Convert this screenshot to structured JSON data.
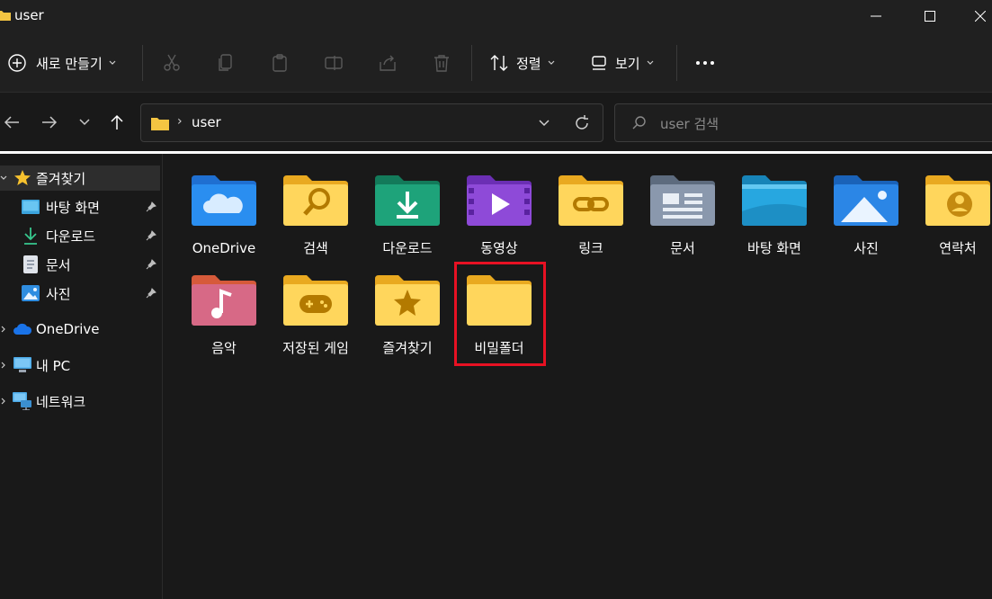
{
  "window": {
    "title": "user"
  },
  "commandbar": {
    "new_label": "새로 만들기",
    "sort_label": "정렬",
    "view_label": "보기"
  },
  "address": {
    "path": "user",
    "search_placeholder": "user 검색"
  },
  "sidebar": {
    "favorites_label": "즐겨찾기",
    "pinned": [
      {
        "label": "바탕 화면",
        "icon": "desktop-icon"
      },
      {
        "label": "다운로드",
        "icon": "download-icon"
      },
      {
        "label": "문서",
        "icon": "document-icon"
      },
      {
        "label": "사진",
        "icon": "pictures-icon"
      }
    ],
    "onedrive_label": "OneDrive",
    "pc_label": "내 PC",
    "network_label": "네트워크"
  },
  "folders": [
    {
      "name": "OneDrive",
      "icon": "onedrive-folder-icon"
    },
    {
      "name": "검색",
      "icon": "search-folder-icon"
    },
    {
      "name": "다운로드",
      "icon": "download-folder-icon"
    },
    {
      "name": "동영상",
      "icon": "videos-folder-icon"
    },
    {
      "name": "링크",
      "icon": "links-folder-icon"
    },
    {
      "name": "문서",
      "icon": "documents-folder-icon"
    },
    {
      "name": "바탕 화면",
      "icon": "desktop-folder-icon"
    },
    {
      "name": "사진",
      "icon": "pictures-folder-icon"
    },
    {
      "name": "연락처",
      "icon": "contacts-folder-icon"
    },
    {
      "name": "음악",
      "icon": "music-folder-icon"
    },
    {
      "name": "저장된 게임",
      "icon": "saved-games-folder-icon"
    },
    {
      "name": "즐겨찾기",
      "icon": "favorites-folder-icon"
    },
    {
      "name": "비밀폴더",
      "icon": "folder-icon"
    }
  ],
  "colors": {
    "background": "#191919",
    "chrome": "#202020",
    "highlight": "#e81123",
    "folder_yellow": "#ffd24d"
  }
}
